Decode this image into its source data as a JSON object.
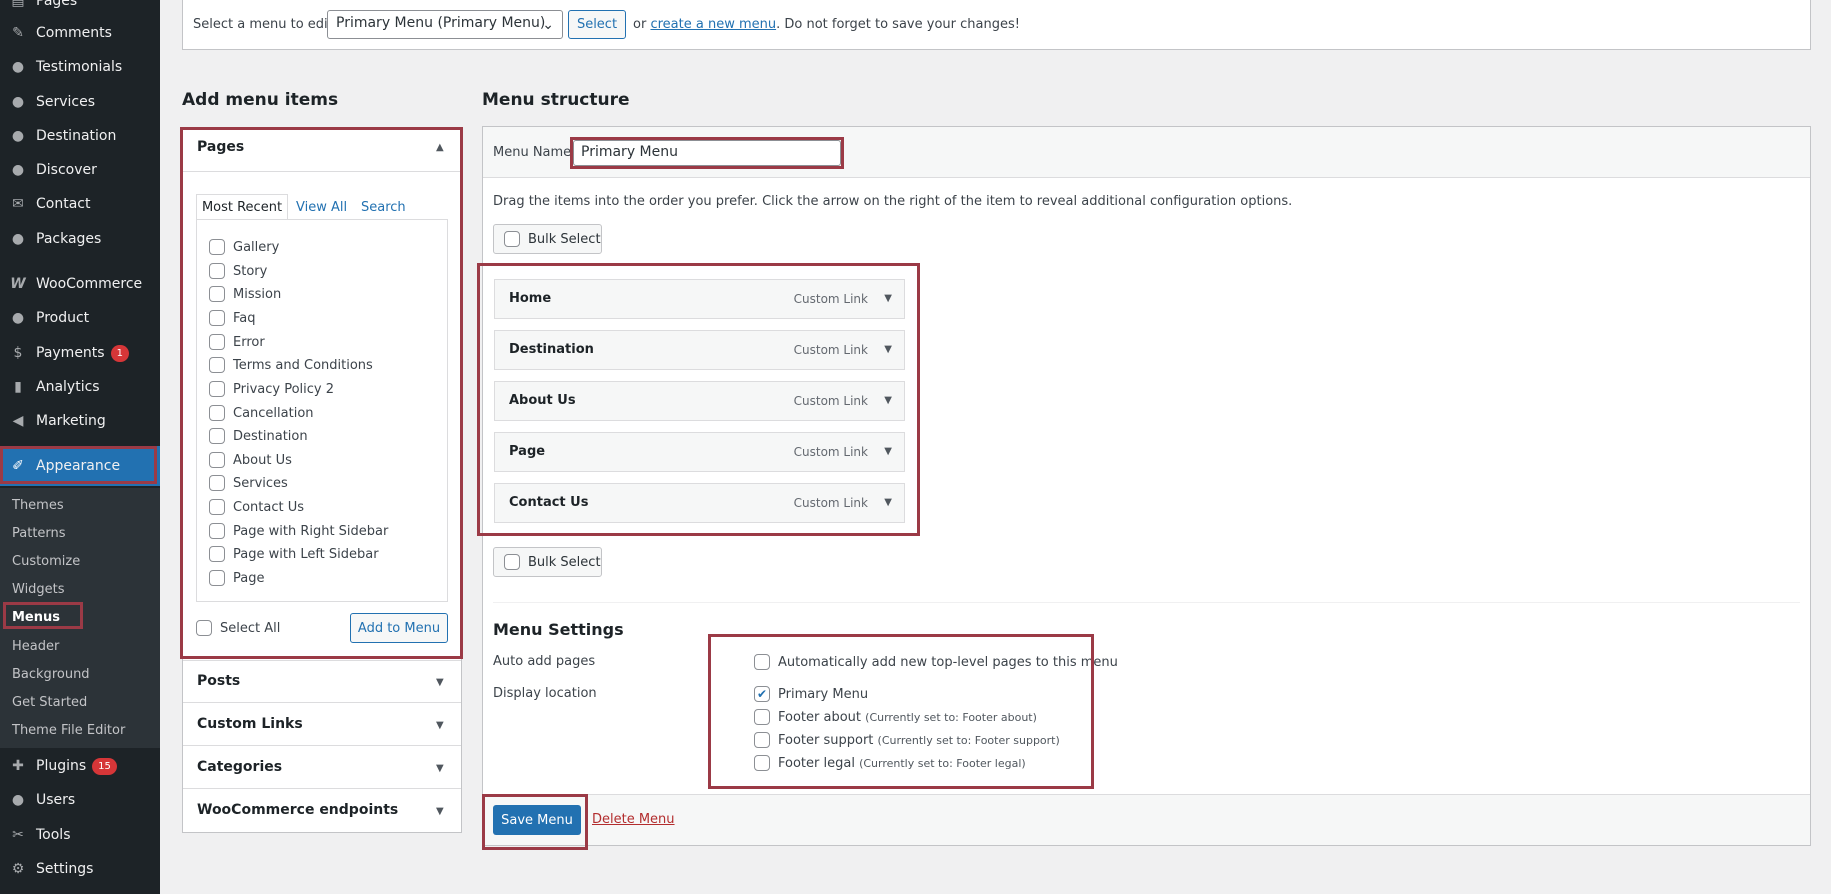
{
  "sidebar": {
    "items": [
      {
        "label": "Pages",
        "icon": "pages-icon",
        "glyph": "▤"
      },
      {
        "label": "Comments",
        "icon": "comments-icon",
        "glyph": "✎"
      },
      {
        "label": "Testimonials",
        "icon": "user-icon",
        "glyph": "●"
      },
      {
        "label": "Services",
        "icon": "user-icon",
        "glyph": "●"
      },
      {
        "label": "Destination",
        "icon": "user-icon",
        "glyph": "●"
      },
      {
        "label": "Discover",
        "icon": "user-icon",
        "glyph": "●"
      },
      {
        "label": "Contact",
        "icon": "mail-icon",
        "glyph": "✉"
      },
      {
        "label": "Packages",
        "icon": "user-icon",
        "glyph": "●"
      },
      {
        "label": "WooCommerce",
        "icon": "woocommerce-icon",
        "glyph": "W"
      },
      {
        "label": "Product",
        "icon": "user-icon",
        "glyph": "●"
      },
      {
        "label": "Payments",
        "icon": "payments-icon",
        "glyph": "$",
        "badge": "1"
      },
      {
        "label": "Analytics",
        "icon": "analytics-icon",
        "glyph": "▮"
      },
      {
        "label": "Marketing",
        "icon": "megaphone-icon",
        "glyph": "◀"
      }
    ],
    "appearance": {
      "label": "Appearance",
      "icon": "brush-icon",
      "glyph": "✐"
    },
    "submenu": [
      "Themes",
      "Patterns",
      "Customize",
      "Widgets",
      "Menus",
      "Header",
      "Background",
      "Get Started",
      "Theme File Editor"
    ],
    "bottom": [
      {
        "label": "Plugins",
        "icon": "plugins-icon",
        "glyph": "✚",
        "badge": "15"
      },
      {
        "label": "Users",
        "icon": "users-icon",
        "glyph": "●"
      },
      {
        "label": "Tools",
        "icon": "tools-icon",
        "glyph": "✂"
      },
      {
        "label": "Settings",
        "icon": "settings-icon",
        "glyph": "⚙"
      }
    ]
  },
  "top": {
    "select_label": "Select a menu to edit:",
    "selected_menu": "Primary Menu (Primary Menu)",
    "select_button": "Select",
    "or": "or",
    "create_link": "create a new menu",
    "reminder": ". Do not forget to save your changes!"
  },
  "add_items": {
    "heading": "Add menu items",
    "pages_title": "Pages",
    "tabs": [
      "Most Recent",
      "View All",
      "Search"
    ],
    "pages": [
      "Gallery",
      "Story",
      "Mission",
      "Faq",
      "Error",
      "Terms and Conditions",
      "Privacy Policy 2",
      "Cancellation",
      "Destination",
      "About Us",
      "Services",
      "Contact Us",
      "Page with Right Sidebar",
      "Page with Left Sidebar",
      "Page"
    ],
    "select_all": "Select All",
    "add_button": "Add to Menu",
    "sections": [
      "Posts",
      "Custom Links",
      "Categories",
      "WooCommerce endpoints"
    ]
  },
  "structure": {
    "heading": "Menu structure",
    "menu_name_label": "Menu Name",
    "menu_name_value": "Primary Menu",
    "instructions": "Drag the items into the order you prefer. Click the arrow on the right of the item to reveal additional configuration options.",
    "bulk_select": "Bulk Select",
    "items": [
      {
        "title": "Home",
        "type": "Custom Link"
      },
      {
        "title": "Destination",
        "type": "Custom Link"
      },
      {
        "title": "About Us",
        "type": "Custom Link"
      },
      {
        "title": "Page",
        "type": "Custom Link"
      },
      {
        "title": "Contact Us",
        "type": "Custom Link"
      }
    ]
  },
  "settings": {
    "heading": "Menu Settings",
    "auto_add_label": "Auto add pages",
    "auto_add_text": "Automatically add new top-level pages to this menu",
    "display_location_label": "Display location",
    "locations": [
      {
        "name": "Primary Menu",
        "note": "",
        "checked": true
      },
      {
        "name": "Footer about",
        "note": "(Currently set to: Footer about)",
        "checked": false
      },
      {
        "name": "Footer support",
        "note": "(Currently set to: Footer support)",
        "checked": false
      },
      {
        "name": "Footer legal",
        "note": "(Currently set to: Footer legal)",
        "checked": false
      }
    ]
  },
  "footer": {
    "save_button": "Save Menu",
    "delete_link": "Delete Menu"
  },
  "colors": {
    "sidebar_bg": "#1d2327",
    "accent": "#2271b1",
    "highlight_border": "#9b3a46",
    "badge": "#d63638",
    "delete": "#b32d2e"
  }
}
